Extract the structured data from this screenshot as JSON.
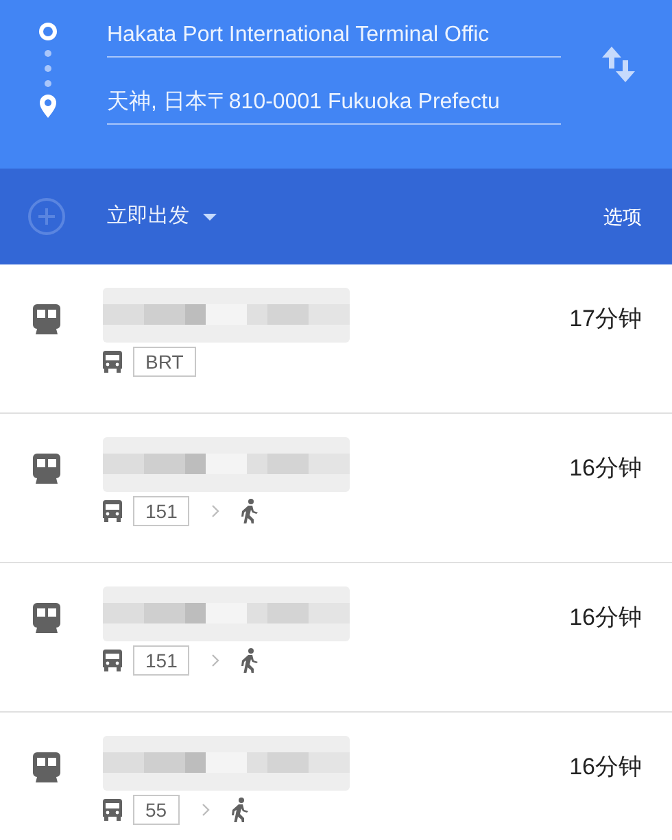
{
  "directions": {
    "origin": {
      "value": "Hakata Port International Terminal Offic"
    },
    "destination": {
      "value": "天神, 日本〒810-0001 Fukuoka Prefectu"
    }
  },
  "options_bar": {
    "departure": "立即出发",
    "options": "选项"
  },
  "routes": [
    {
      "duration": "17分钟",
      "steps": [
        {
          "kind": "bus",
          "label": "BRT"
        }
      ]
    },
    {
      "duration": "16分钟",
      "steps": [
        {
          "kind": "bus",
          "label": "151"
        },
        {
          "kind": "walk"
        }
      ]
    },
    {
      "duration": "16分钟",
      "steps": [
        {
          "kind": "bus",
          "label": "151"
        },
        {
          "kind": "walk"
        }
      ]
    },
    {
      "duration": "16分钟",
      "steps": [
        {
          "kind": "bus",
          "label": "55"
        },
        {
          "kind": "walk"
        }
      ]
    }
  ]
}
